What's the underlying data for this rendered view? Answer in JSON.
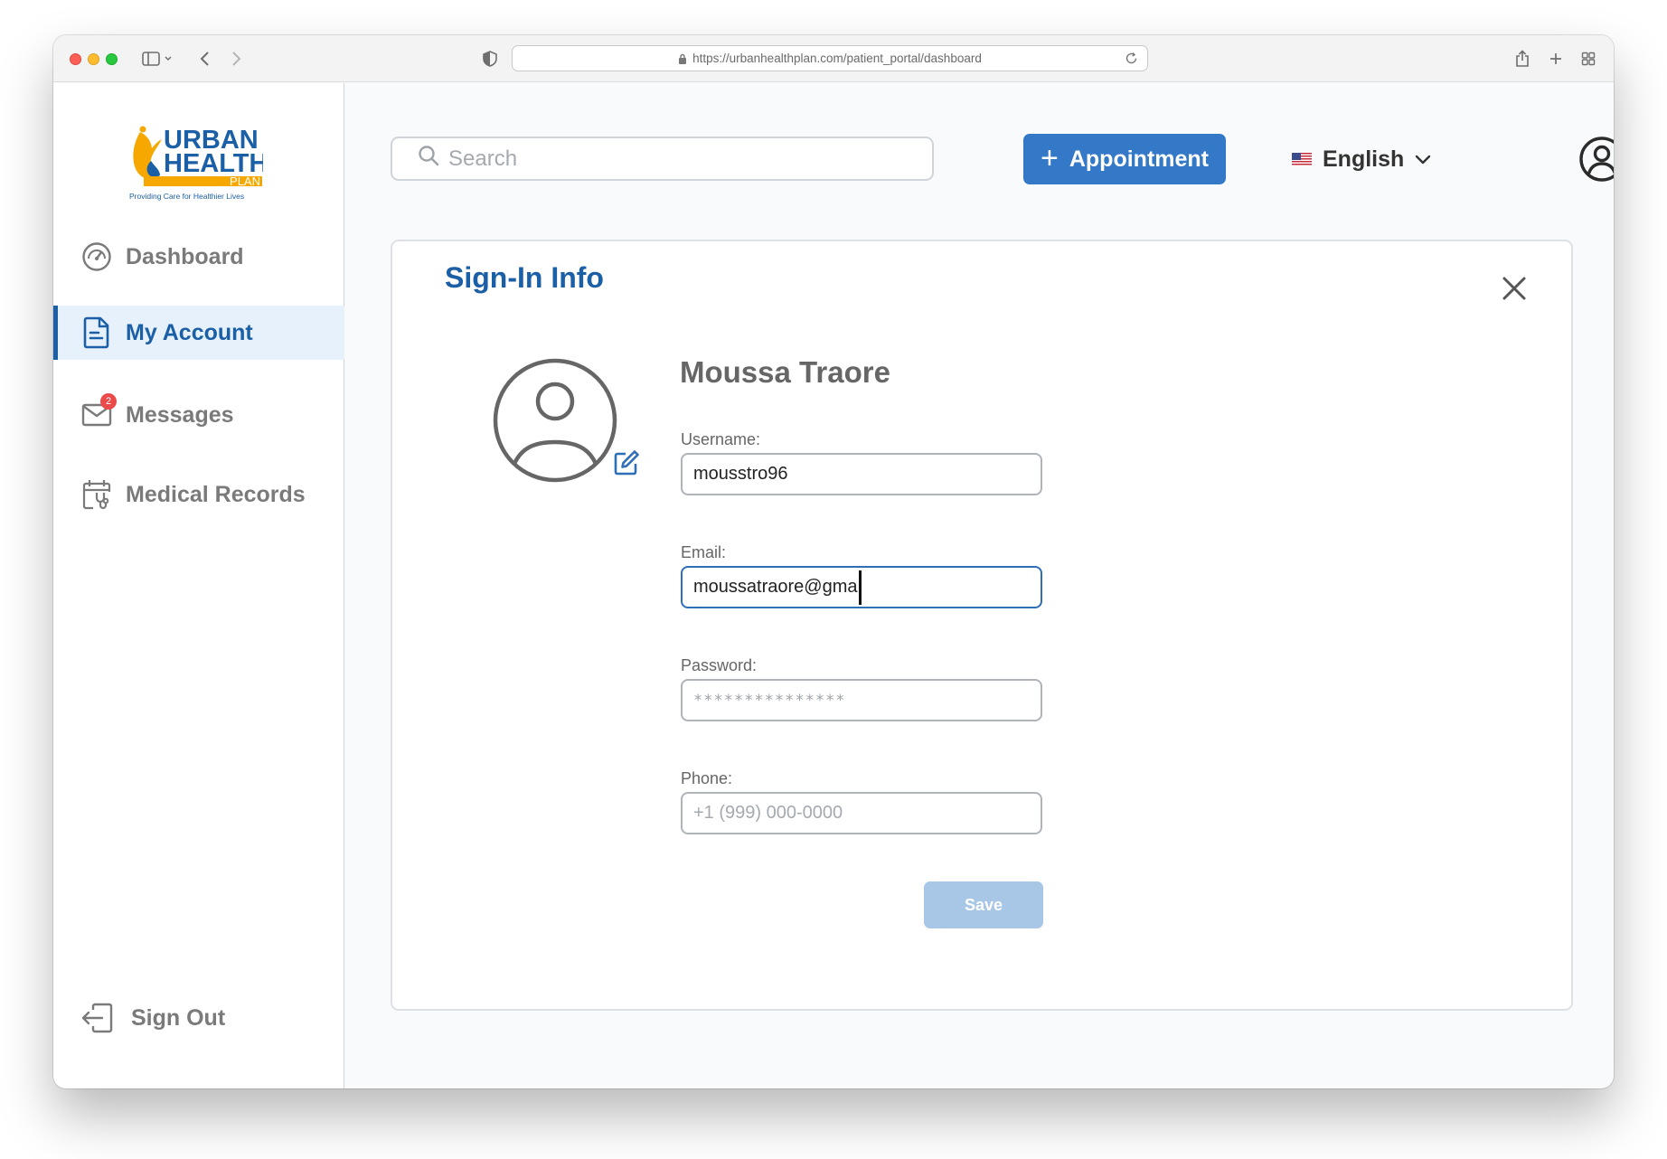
{
  "browser": {
    "url": "https://urbanhealthplan.com/patient_portal/dashboard"
  },
  "brand": {
    "line1": "URBAN",
    "line2": "HEALTH",
    "line3": "PLAN",
    "tagline": "Providing Care for Healthier Lives",
    "primary_color": "#1b5fa6",
    "accent_color": "#f6a800"
  },
  "sidebar": {
    "items": [
      {
        "label": "Dashboard",
        "icon": "gauge-icon"
      },
      {
        "label": "My Account",
        "icon": "document-icon",
        "active": true
      },
      {
        "label": "Messages",
        "icon": "envelope-icon",
        "badge": "2"
      },
      {
        "label": "Medical Records",
        "icon": "calendar-stethoscope-icon"
      }
    ],
    "sign_out": "Sign Out"
  },
  "header": {
    "search_placeholder": "Search",
    "appointment_label": "Appointment",
    "appointment_plus": "+",
    "language": "English"
  },
  "card": {
    "title": "Sign-In Info",
    "user_name": "Moussa Traore",
    "fields": {
      "username": {
        "label": "Username:",
        "value": "mousstro96"
      },
      "email": {
        "label": "Email:",
        "value": "moussatraore@gma"
      },
      "password": {
        "label": "Password:",
        "mask": "***************"
      },
      "phone": {
        "label": "Phone:",
        "placeholder": "+1 (999) 000-0000"
      }
    },
    "save_label": "Save"
  }
}
